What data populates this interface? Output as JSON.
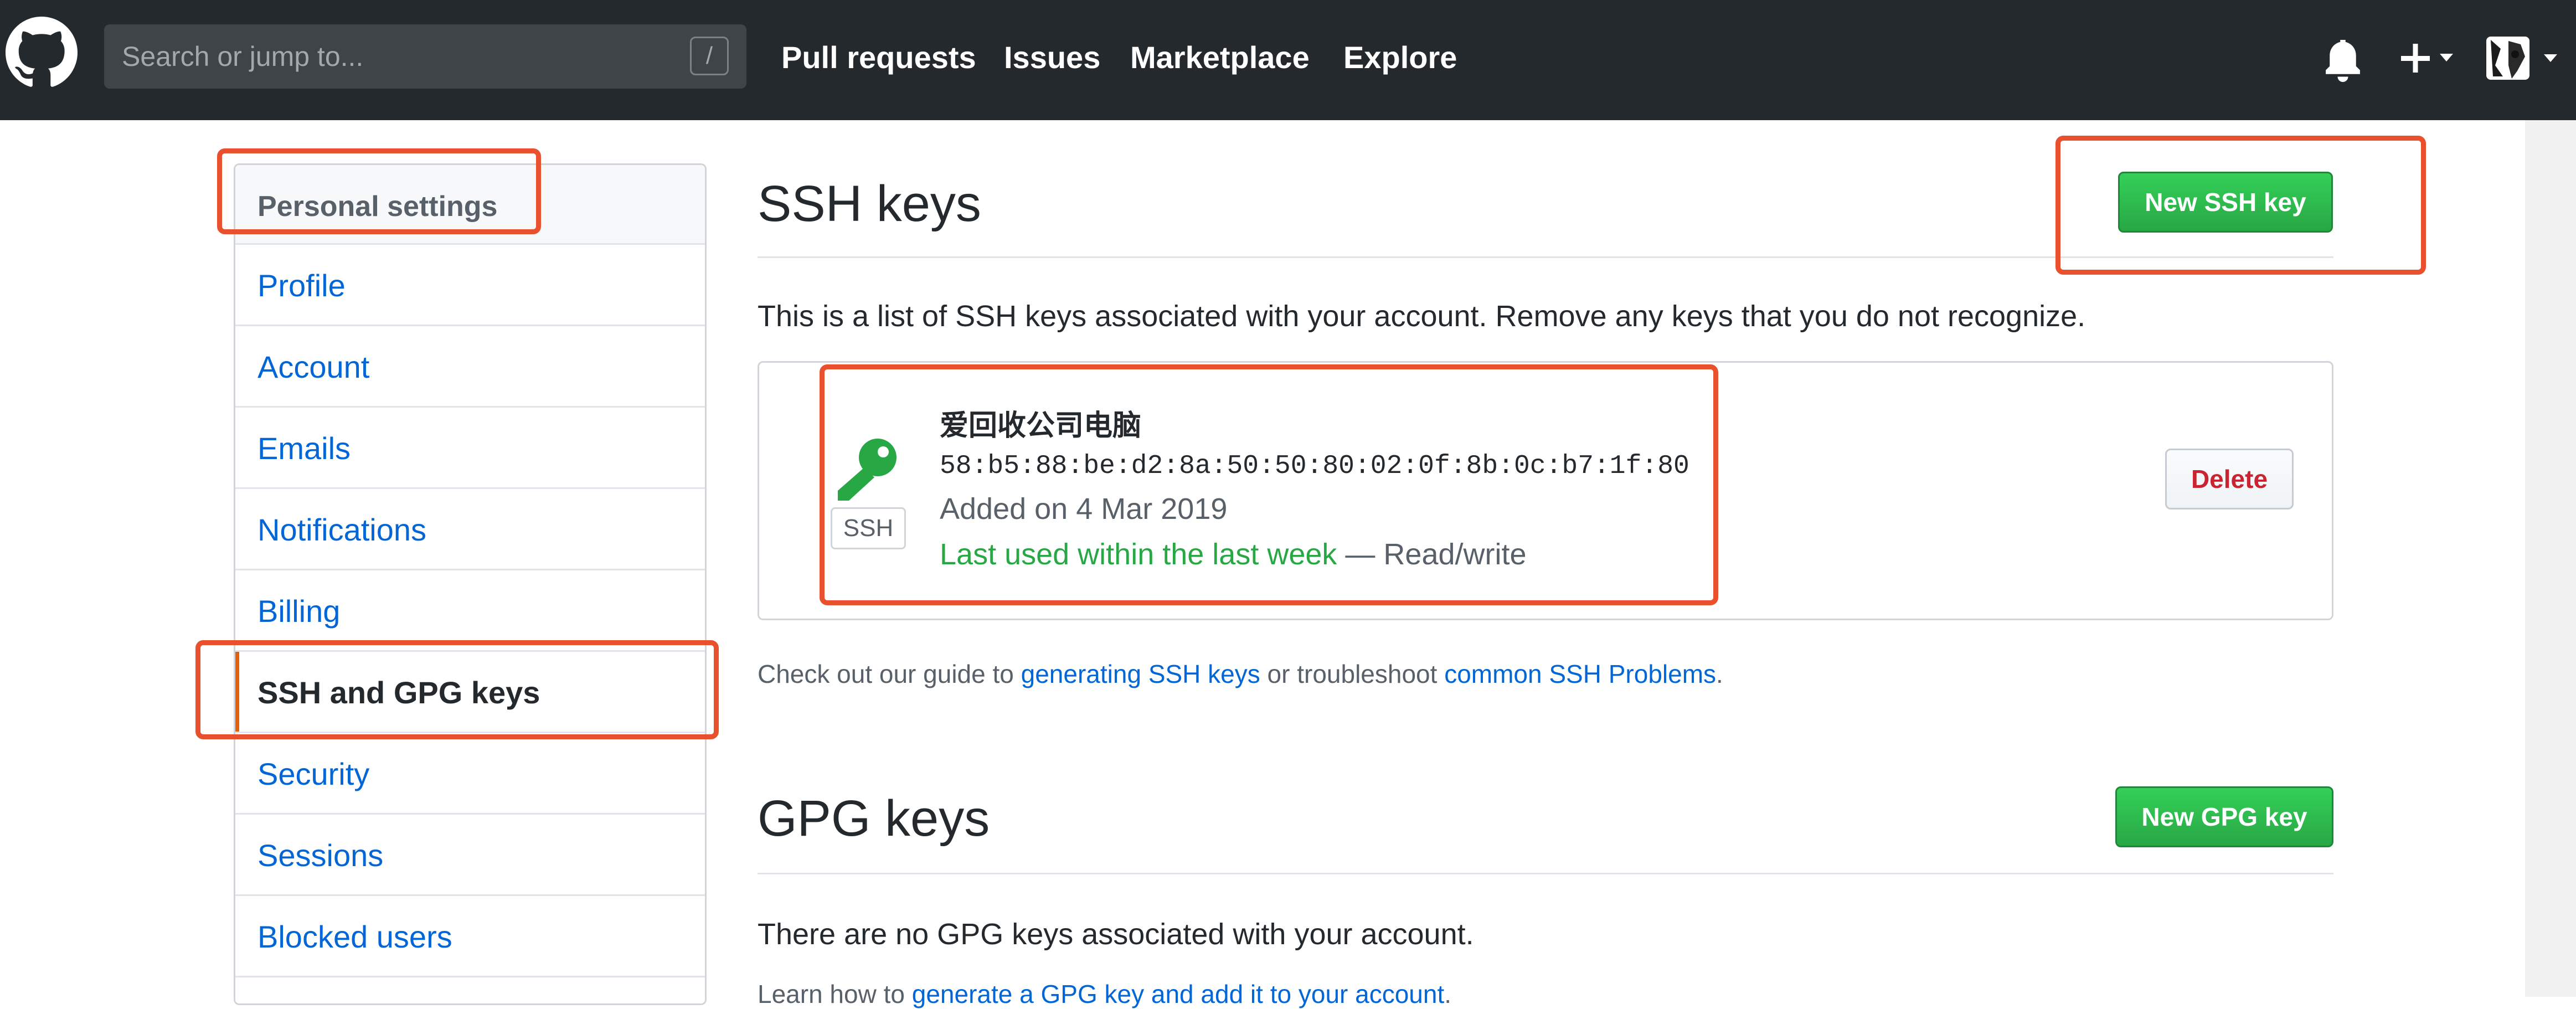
{
  "header": {
    "search_placeholder": "Search or jump to...",
    "search_shortcut": "/",
    "nav": [
      "Pull requests",
      "Issues",
      "Marketplace",
      "Explore"
    ]
  },
  "sidebar": {
    "heading": "Personal settings",
    "items": [
      {
        "label": "Profile",
        "selected": false
      },
      {
        "label": "Account",
        "selected": false
      },
      {
        "label": "Emails",
        "selected": false
      },
      {
        "label": "Notifications",
        "selected": false
      },
      {
        "label": "Billing",
        "selected": false
      },
      {
        "label": "SSH and GPG keys",
        "selected": true
      },
      {
        "label": "Security",
        "selected": false
      },
      {
        "label": "Sessions",
        "selected": false
      },
      {
        "label": "Blocked users",
        "selected": false
      }
    ]
  },
  "ssh": {
    "title": "SSH keys",
    "new_button": "New SSH key",
    "description": "This is a list of SSH keys associated with your account. Remove any keys that you do not recognize.",
    "key": {
      "badge": "SSH",
      "name": "爱回收公司电脑",
      "fingerprint": "58:b5:88:be:d2:8a:50:50:80:02:0f:8b:0c:b7:1f:80",
      "added": "Added on 4 Mar 2019",
      "last_used": "Last used within the last week",
      "access": "— Read/write",
      "delete_label": "Delete"
    },
    "guide": {
      "prefix": "Check out our guide to ",
      "link1": "generating SSH keys",
      "middle": " or troubleshoot ",
      "link2": "common SSH Problems",
      "suffix": "."
    }
  },
  "gpg": {
    "title": "GPG keys",
    "new_button": "New GPG key",
    "empty": "There are no GPG keys associated with your account.",
    "learn_prefix": "Learn how to ",
    "learn_link": "generate a GPG key and add it to your account",
    "learn_suffix": "."
  },
  "colors": {
    "header_bg": "#24292e",
    "link": "#0366d6",
    "green": "#28a745",
    "danger": "#cb2431",
    "annotation": "#e8502e"
  }
}
